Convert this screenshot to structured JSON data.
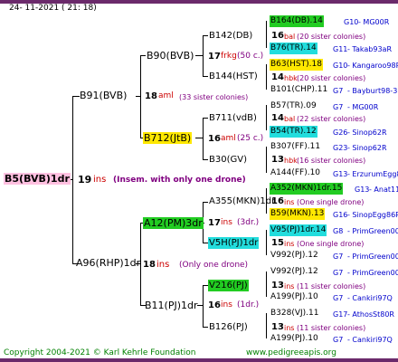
{
  "header": {
    "datetime": "24- 11-2021 ( 21: 18)"
  },
  "root": {
    "name": "B5(BVB)1dr"
  },
  "gen1": {
    "sire": {
      "name": "B91(BVB)",
      "num": "18",
      "code": "aml",
      "info": "(33 sister colonies)"
    },
    "dam": {
      "name": "A96(RHP)1dr",
      "num": "18",
      "code": "ins",
      "info": "(Only one drone)"
    },
    "inst": {
      "num": "19",
      "code": "ins",
      "info": "(Insem. with only one drone)"
    }
  },
  "gen2": {
    "a": {
      "name": "B90(BVB)",
      "num": "17",
      "code": "frkg",
      "info": "(50 c.)"
    },
    "b": {
      "name": "B712(JtB)",
      "num": "16",
      "code": "aml",
      "info": "(25 c.)"
    },
    "c": {
      "name": "A12(PM)3dr",
      "num": "17",
      "code": "ins",
      "info": "(3dr.)"
    },
    "d": {
      "name": "B11(PJ)1dr",
      "num": "16",
      "code": "ins",
      "info": "(1dr.)"
    }
  },
  "gen3": {
    "a": {
      "name": "B142(DB)",
      "num": "16",
      "code": "bal",
      "info": "(20 sister colonies)"
    },
    "b": {
      "name": "B144(HST)",
      "num": "14",
      "code": "hbk",
      "info": "(20 sister colonies)"
    },
    "c": {
      "name": "B711(vdB)",
      "num": "14",
      "code": "bal",
      "info": "(22 sister colonies)"
    },
    "d": {
      "name": "B30(GV)",
      "num": "13",
      "code": "hbk",
      "info": "(16 sister colonies)"
    },
    "e": {
      "name": "A355(MKN)1dr",
      "num": "16",
      "code": "ins",
      "info": "(One single drone)"
    },
    "f": {
      "name": "V5H(PJ)1dr",
      "num": "15",
      "code": "ins",
      "info": "(One single drone)"
    },
    "g": {
      "name": "V216(PJ)",
      "num": "13",
      "code": "ins",
      "info": "(11 sister colonies)"
    },
    "h": {
      "name": "B126(PJ)",
      "num": "13",
      "code": "ins",
      "info": "(11 sister colonies)"
    }
  },
  "gen4": [
    {
      "name": "B164(DB).14",
      "gen": "G10",
      "line": "MG00R"
    },
    {
      "name": "B76(TR).14",
      "gen": "G11",
      "line": "Takab93aR"
    },
    {
      "name": "B63(HST).18",
      "gen": "G10",
      "line": "Kangaroo98R"
    },
    {
      "name": "B101(CHP).11",
      "gen": "G7",
      "line": "Bayburt98-3"
    },
    {
      "name": "B57(TR).09",
      "gen": "G7",
      "line": "MG00R"
    },
    {
      "name": "B54(TR).12",
      "gen": "G26",
      "line": "Sinop62R"
    },
    {
      "name": "B307(FF).11",
      "gen": "G23",
      "line": "Sinop62R"
    },
    {
      "name": "A144(FF).10",
      "gen": "G13",
      "line": "ErzurumEgg8"
    },
    {
      "name": "A352(MKN)1dr.15",
      "gen": "G13",
      "line": "Anat11Q"
    },
    {
      "name": "B59(MKN).13",
      "gen": "G16",
      "line": "SinopEgg86R"
    },
    {
      "name": "V95(PJ)1dr.14",
      "gen": "G8",
      "line": "PrimGreen00"
    },
    {
      "name": "V992(PJ).12",
      "gen": "G7",
      "line": "PrimGreen00"
    },
    {
      "name": "V992(PJ).12",
      "gen": "G7",
      "line": "PrimGreen00"
    },
    {
      "name": "A199(PJ).10",
      "gen": "G7",
      "line": "Cankiri97Q"
    },
    {
      "name": "B328(VJ).11",
      "gen": "G17",
      "line": "AthosSt80R"
    },
    {
      "name": "A199(PJ).10",
      "gen": "G7",
      "line": "Cankiri97Q"
    }
  ],
  "footer": {
    "copyright": "Copyright 2004-2021 © Karl Kehrle Foundation",
    "url": "www.pedigreeapis.org"
  }
}
